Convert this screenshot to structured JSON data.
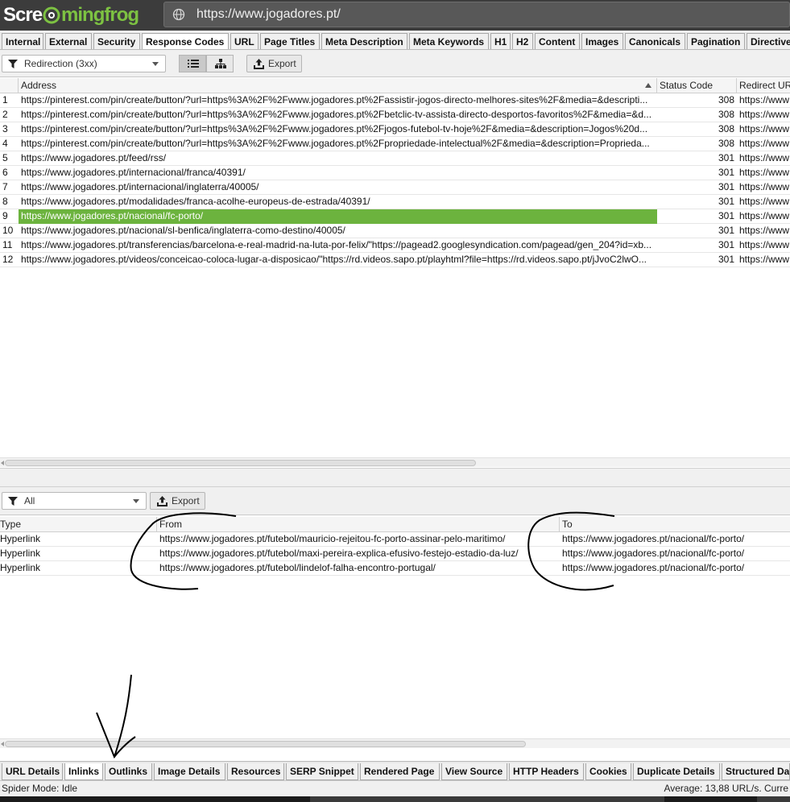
{
  "app": {
    "logo_left": "Scre",
    "logo_right": "mingfrog",
    "url": "https://www.jogadores.pt/"
  },
  "top_tabs": [
    {
      "label": "Internal"
    },
    {
      "label": "External"
    },
    {
      "label": "Security"
    },
    {
      "label": "Response Codes",
      "active": true
    },
    {
      "label": "URL"
    },
    {
      "label": "Page Titles"
    },
    {
      "label": "Meta Description"
    },
    {
      "label": "Meta Keywords"
    },
    {
      "label": "H1"
    },
    {
      "label": "H2"
    },
    {
      "label": "Content"
    },
    {
      "label": "Images"
    },
    {
      "label": "Canonicals"
    },
    {
      "label": "Pagination"
    },
    {
      "label": "Directive"
    }
  ],
  "top_toolbar": {
    "filter_value": "Redirection (3xx)",
    "export_label": "Export",
    "icons": [
      "filter-icon",
      "list-view-icon",
      "tree-view-icon",
      "export-icon"
    ]
  },
  "main_table": {
    "columns": [
      "Address",
      "Status Code",
      "Redirect UR"
    ],
    "rows": [
      {
        "n": "1",
        "address": "https://pinterest.com/pin/create/button/?url=https%3A%2F%2Fwww.jogadores.pt%2Fassistir-jogos-directo-melhores-sites%2F&media=&descripti...",
        "status": "308",
        "redirect": "https://www"
      },
      {
        "n": "2",
        "address": "https://pinterest.com/pin/create/button/?url=https%3A%2F%2Fwww.jogadores.pt%2Fbetclic-tv-assista-directo-desportos-favoritos%2F&media=&d...",
        "status": "308",
        "redirect": "https://www"
      },
      {
        "n": "3",
        "address": "https://pinterest.com/pin/create/button/?url=https%3A%2F%2Fwww.jogadores.pt%2Fjogos-futebol-tv-hoje%2F&media=&description=Jogos%20d...",
        "status": "308",
        "redirect": "https://www"
      },
      {
        "n": "4",
        "address": "https://pinterest.com/pin/create/button/?url=https%3A%2F%2Fwww.jogadores.pt%2Fpropriedade-intelectual%2F&media=&description=Proprieda...",
        "status": "308",
        "redirect": "https://www"
      },
      {
        "n": "5",
        "address": "https://www.jogadores.pt/feed/rss/",
        "status": "301",
        "redirect": "https://www"
      },
      {
        "n": "6",
        "address": "https://www.jogadores.pt/internacional/franca/40391/",
        "status": "301",
        "redirect": "https://www"
      },
      {
        "n": "7",
        "address": "https://www.jogadores.pt/internacional/inglaterra/40005/",
        "status": "301",
        "redirect": "https://www"
      },
      {
        "n": "8",
        "address": "https://www.jogadores.pt/modalidades/franca-acolhe-europeus-de-estrada/40391/",
        "status": "301",
        "redirect": "https://www"
      },
      {
        "n": "9",
        "address": "https://www.jogadores.pt/nacional/fc-porto/",
        "status": "301",
        "redirect": "https://www",
        "selected": true
      },
      {
        "n": "10",
        "address": "https://www.jogadores.pt/nacional/sl-benfica/inglaterra-como-destino/40005/",
        "status": "301",
        "redirect": "https://www"
      },
      {
        "n": "11",
        "address": "https://www.jogadores.pt/transferencias/barcelona-e-real-madrid-na-luta-por-felix/\"https://pagead2.googlesyndication.com/pagead/gen_204?id=xb...",
        "status": "301",
        "redirect": "https://www"
      },
      {
        "n": "12",
        "address": "https://www.jogadores.pt/videos/conceicao-coloca-lugar-a-disposicao/\"https://rd.videos.sapo.pt/playhtml?file=https://rd.videos.sapo.pt/jJvoC2lwO...",
        "status": "301",
        "redirect": "https://www"
      }
    ]
  },
  "bottom_toolbar": {
    "filter_value": "All",
    "export_label": "Export"
  },
  "inlinks_table": {
    "columns": [
      "Type",
      "From",
      "To"
    ],
    "rows": [
      {
        "type": "Hyperlink",
        "from": "https://www.jogadores.pt/futebol/mauricio-rejeitou-fc-porto-assinar-pelo-maritimo/",
        "to": "https://www.jogadores.pt/nacional/fc-porto/"
      },
      {
        "type": "Hyperlink",
        "from": "https://www.jogadores.pt/futebol/maxi-pereira-explica-efusivo-festejo-estadio-da-luz/",
        "to": "https://www.jogadores.pt/nacional/fc-porto/"
      },
      {
        "type": "Hyperlink",
        "from": "https://www.jogadores.pt/futebol/lindelof-falha-encontro-portugal/",
        "to": "https://www.jogadores.pt/nacional/fc-porto/"
      }
    ]
  },
  "bottom_tabs": [
    {
      "label": "URL Details"
    },
    {
      "label": "Inlinks",
      "active": true
    },
    {
      "label": "Outlinks"
    },
    {
      "label": "Image Details"
    },
    {
      "label": "Resources"
    },
    {
      "label": "SERP Snippet"
    },
    {
      "label": "Rendered Page"
    },
    {
      "label": "View Source"
    },
    {
      "label": "HTTP Headers"
    },
    {
      "label": "Cookies"
    },
    {
      "label": "Duplicate Details"
    },
    {
      "label": "Structured Da"
    }
  ],
  "status": {
    "left": "Spider Mode: Idle",
    "right": "Average: 13,88 URL/s. Curre"
  }
}
